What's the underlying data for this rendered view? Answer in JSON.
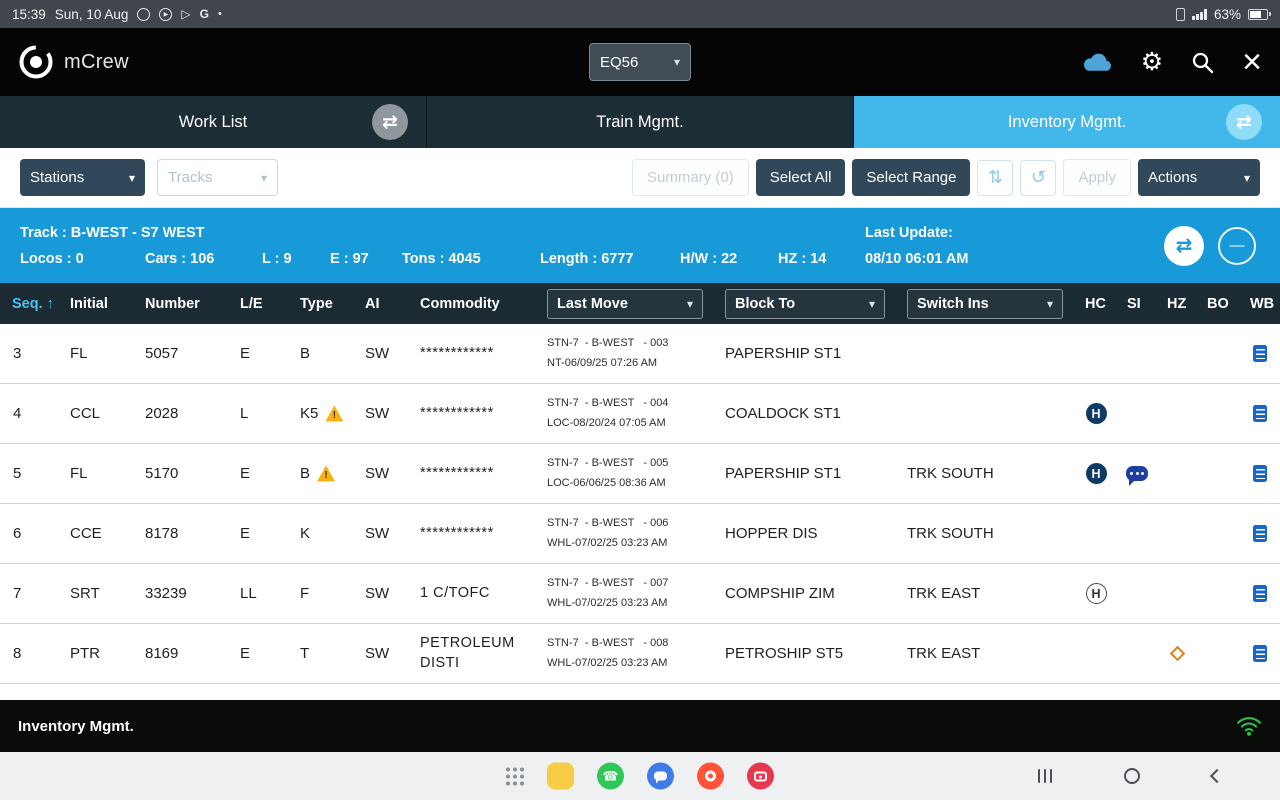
{
  "status_bar": {
    "time": "15:39",
    "date": "Sun, 10 Aug",
    "battery_percent": "63%"
  },
  "header": {
    "app_name": "mCrew",
    "train_selector_value": "EQ56"
  },
  "tabs": {
    "work_list": "Work List",
    "train_mgmt": "Train Mgmt.",
    "inventory_mgmt": "Inventory Mgmt."
  },
  "toolbar": {
    "stations": "Stations",
    "tracks": "Tracks",
    "summary": "Summary (0)",
    "select_all": "Select All",
    "select_range": "Select Range",
    "apply": "Apply",
    "actions": "Actions"
  },
  "track_info": {
    "track_label": "Track :",
    "track_value": "B-WEST - S7 WEST",
    "stats": [
      {
        "label": "Locos :",
        "value": "0"
      },
      {
        "label": "Cars :",
        "value": "106"
      },
      {
        "label": "L :",
        "value": "9"
      },
      {
        "label": "E :",
        "value": "97"
      },
      {
        "label": "Tons :",
        "value": "4045"
      },
      {
        "label": "Length :",
        "value": "6777"
      },
      {
        "label": "H/W :",
        "value": "22"
      },
      {
        "label": "HZ :",
        "value": "14"
      }
    ],
    "last_update_label": "Last Update:",
    "last_update_value": "08/10 06:01 AM"
  },
  "table": {
    "columns": [
      "Seq.",
      "Initial",
      "Number",
      "L/E",
      "Type",
      "AI",
      "Commodity",
      "Last Move",
      "Block To",
      "Switch Ins",
      "HC",
      "SI",
      "HZ",
      "BO",
      "WB"
    ],
    "rows": [
      {
        "seq": "3",
        "initial": "FL",
        "number": "5057",
        "le": "E",
        "type": "B",
        "type_warning": false,
        "ai": "SW",
        "commodity": "************",
        "last_move_1": "STN-7  - B-WEST   - 003",
        "last_move_2": "NT-06/09/25 07:26 AM",
        "block_to": "PAPERSHIP ST1",
        "switch_ins": "",
        "hc_badge": "",
        "si_comment": false,
        "hz_diamond": false,
        "wb_doc": true
      },
      {
        "seq": "4",
        "initial": "CCL",
        "number": "2028",
        "le": "L",
        "type": "K5",
        "type_warning": true,
        "ai": "SW",
        "commodity": "************",
        "last_move_1": "STN-7  - B-WEST   - 004",
        "last_move_2": "LOC-08/20/24 07:05 AM",
        "block_to": "COALDOCK ST1",
        "switch_ins": "",
        "hc_badge": "filled",
        "si_comment": false,
        "hz_diamond": false,
        "wb_doc": true
      },
      {
        "seq": "5",
        "initial": "FL",
        "number": "5170",
        "le": "E",
        "type": "B",
        "type_warning": true,
        "ai": "SW",
        "commodity": "************",
        "last_move_1": "STN-7  - B-WEST   - 005",
        "last_move_2": "LOC-06/06/25 08:36 AM",
        "block_to": "PAPERSHIP ST1",
        "switch_ins": "TRK SOUTH",
        "hc_badge": "filled",
        "si_comment": true,
        "hz_diamond": false,
        "wb_doc": true
      },
      {
        "seq": "6",
        "initial": "CCE",
        "number": "8178",
        "le": "E",
        "type": "K",
        "type_warning": false,
        "ai": "SW",
        "commodity": "************",
        "last_move_1": "STN-7  - B-WEST   - 006",
        "last_move_2": "WHL-07/02/25 03:23 AM",
        "block_to": "HOPPER DIS",
        "switch_ins": "TRK SOUTH",
        "hc_badge": "",
        "si_comment": false,
        "hz_diamond": false,
        "wb_doc": true
      },
      {
        "seq": "7",
        "initial": "SRT",
        "number": "33239",
        "le": "LL",
        "type": "F",
        "type_warning": false,
        "ai": "SW",
        "commodity": "1 C/TOFC",
        "last_move_1": "STN-7  - B-WEST   - 007",
        "last_move_2": "WHL-07/02/25 03:23 AM",
        "block_to": "COMPSHIP ZIM",
        "switch_ins": "TRK EAST",
        "hc_badge": "outlined",
        "si_comment": false,
        "hz_diamond": false,
        "wb_doc": true
      },
      {
        "seq": "8",
        "initial": "PTR",
        "number": "8169",
        "le": "E",
        "type": "T",
        "type_warning": false,
        "ai": "SW",
        "commodity": "PETROLEUM DISTI",
        "last_move_1": "STN-7  - B-WEST   - 008",
        "last_move_2": "WHL-07/02/25 03:23 AM",
        "block_to": "PETROSHIP ST5",
        "switch_ins": "TRK EAST",
        "hc_badge": "",
        "si_comment": false,
        "hz_diamond": true,
        "wb_doc": true
      }
    ]
  },
  "footer": {
    "title": "Inventory Mgmt."
  },
  "icons": {
    "swap": "⇄",
    "chevron_down": "▾",
    "sort_up": "↑",
    "sync": "⇅",
    "undo": "↺",
    "close": "×",
    "gear": "⚙",
    "minus": "—",
    "warning_mark": "!",
    "hc_letter": "H",
    "phone": "☎",
    "play_outline": "▷",
    "play_filled": "▶",
    "google": "G",
    "bullet": "•"
  },
  "colors": {
    "accent_cyan": "#41b8e9",
    "infobar_blue": "#1899d8",
    "header_dark": "#1c2a33",
    "button_dark": "#31475a",
    "warning_amber": "#f4b313",
    "doc_blue": "#1565cb",
    "wifi_green": "#2fbe4f"
  }
}
